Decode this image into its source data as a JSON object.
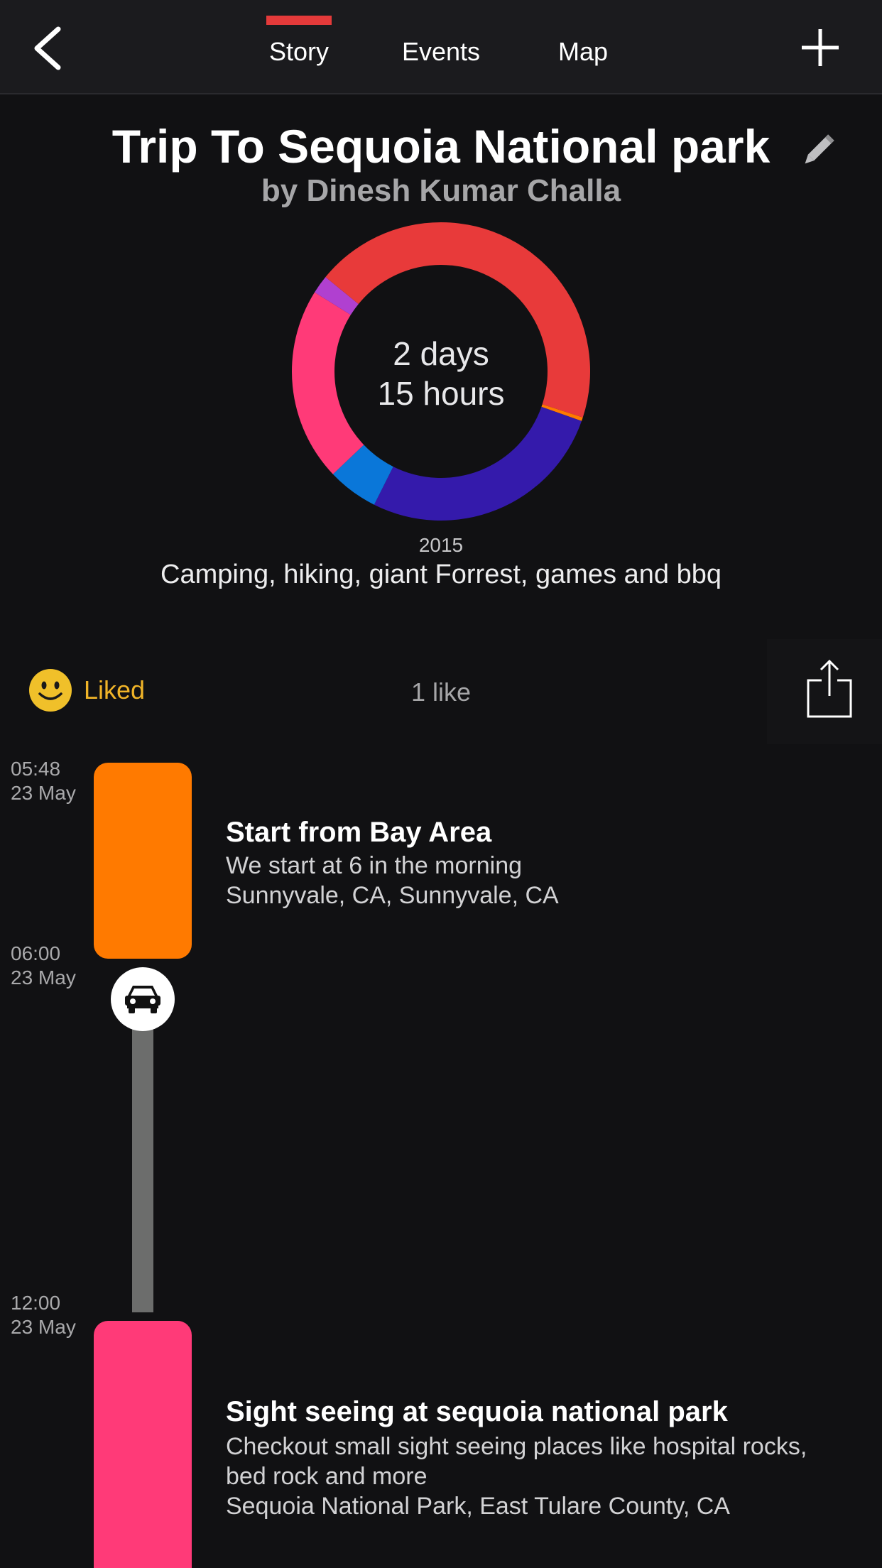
{
  "nav": {
    "tabs": [
      {
        "label": "Story",
        "active": true
      },
      {
        "label": "Events",
        "active": false
      },
      {
        "label": "Map",
        "active": false
      }
    ],
    "back_icon": "chevron-left-icon",
    "add_icon": "plus-icon",
    "indicator_color": "#e43a3a"
  },
  "story": {
    "title": "Trip To Sequoia National park",
    "author": "by Dinesh Kumar Challa",
    "edit_icon": "pencil-icon",
    "duration_line1": "2 days",
    "duration_line2": "15 hours",
    "year": "2015",
    "description": "Camping, hiking, giant Forrest, games and bbq"
  },
  "duration_chart": {
    "type": "pie",
    "segments": [
      {
        "color": "#e83a3a",
        "fraction": 0.3
      },
      {
        "color": "#ff7a00",
        "fraction": 0.004
      },
      {
        "color": "#341aab",
        "fraction": 0.27
      },
      {
        "color": "#0a77d9",
        "fraction": 0.055
      },
      {
        "color": "#ff3a78",
        "fraction": 0.21
      },
      {
        "color": "#b040d0",
        "fraction": 0.02
      },
      {
        "color": "#e83a3a",
        "fraction": 0.141
      }
    ]
  },
  "social": {
    "liked_label": "Liked",
    "likes_count": "1 like",
    "liked_color": "#f0b428",
    "smiley_icon": "smiley-icon",
    "share_icon": "share-icon"
  },
  "timeline": {
    "times": [
      {
        "time": "05:48",
        "date": "23 May"
      },
      {
        "time": "06:00",
        "date": "23 May"
      },
      {
        "time": "12:00",
        "date": "23 May"
      }
    ],
    "events": [
      {
        "title": "Start from Bay Area",
        "description": "We start at 6 in the morning",
        "location": "Sunnyvale, CA, Sunnyvale, CA",
        "color": "#ff7a00"
      },
      {
        "title": "Sight seeing at sequoia national park",
        "description_line1": "Checkout small sight seeing places like hospital rocks,",
        "description_line2": "bed rock and more",
        "location": "Sequoia National Park, East Tulare County, CA",
        "color": "#ff3a78"
      }
    ],
    "transport_icon": "car-icon"
  }
}
